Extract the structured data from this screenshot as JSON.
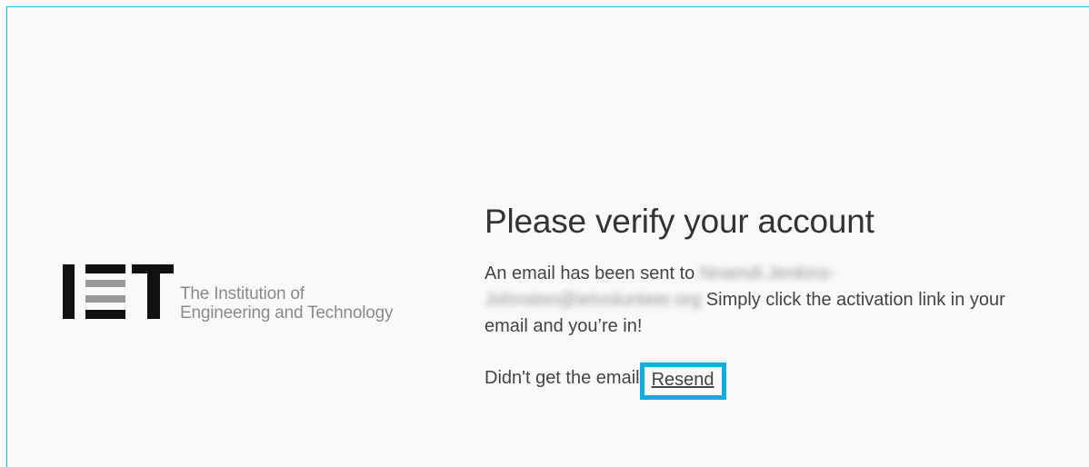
{
  "logo": {
    "mark": "IET",
    "line1": "The Institution of",
    "line2": "Engineering and Technology"
  },
  "verify": {
    "title": "Please verify your account",
    "message_prefix": "An email has been sent to",
    "email_redacted": "Nnamdi.Jenkins-Johnston@ietvolunteer.org",
    "message_suffix": "Simply click the activation link in your email and you’re in!",
    "resend_prompt": "Didn't get the email",
    "resend_label": "Resend"
  },
  "colors": {
    "accent_border": "#10aee0",
    "frame_border": "#1cb4e6",
    "background": "#f9f9f9"
  }
}
